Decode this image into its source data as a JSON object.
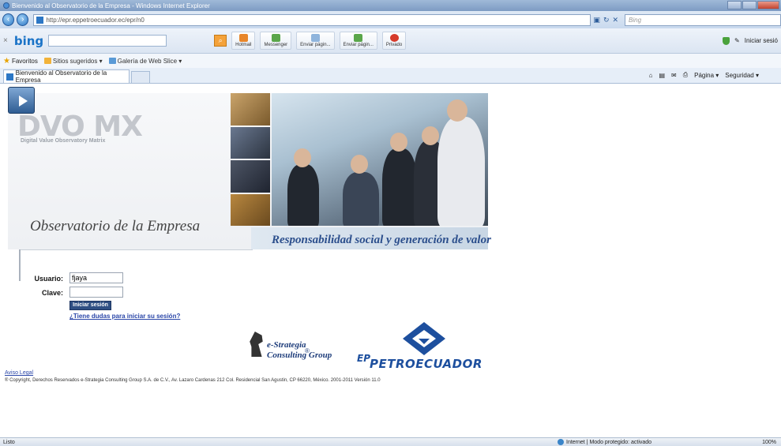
{
  "window": {
    "title": "Bienvenido al Observatorio de la Empresa - Windows Internet Explorer"
  },
  "browser": {
    "url": "http://epr.eppetroecuador.ec/epr/n0",
    "search_placeholder": "Bing",
    "bing_logo": "bing",
    "toolbar_buttons": [
      "Hotmail",
      "Messenger",
      "Enviar págin...",
      "Enviar págin...",
      "Privado"
    ],
    "iniciar_sesion": "Iniciar sesió",
    "favorites_label": "Favoritos",
    "fav_items": [
      "Sitios sugeridos ▾",
      "Galería de Web Slice ▾"
    ],
    "tab_title": "Bienvenido al Observatorio de la Empresa",
    "cmd_items": [
      "Página ▾",
      "Seguridad ▾"
    ]
  },
  "hero": {
    "logo_text": "DVO MX",
    "logo_sub": "Digital Value Observatory Matrix",
    "title": "Observatorio de la Empresa",
    "slogan": "Responsabilidad social y generación de valor"
  },
  "login": {
    "user_label": "Usuario:",
    "user_value": "fjaya",
    "pass_label": "Clave:",
    "submit_label": "Iniciar sesión",
    "help_link": "¿Tiene dudas para iniciar su sesión?"
  },
  "logos": {
    "estrategia_line1": "e-Strategia",
    "estrategia_line2": "Consulting Group",
    "registered": "®",
    "ep": "EP",
    "petro": "PETROECUADOR"
  },
  "footer": {
    "aviso": "Aviso Legal",
    "copyright": "® Copyright, Derechos Reservados e-Strategia Consulting Group S.A. de C.V., Av. Lazaro Cardenas 212 Col. Residencial San Agustin, CP 66220, México. 2001-2011 Versión 11.0"
  },
  "status": {
    "left": "Listo",
    "zone": "Internet | Modo protegido: activado",
    "zoom": "100%"
  }
}
